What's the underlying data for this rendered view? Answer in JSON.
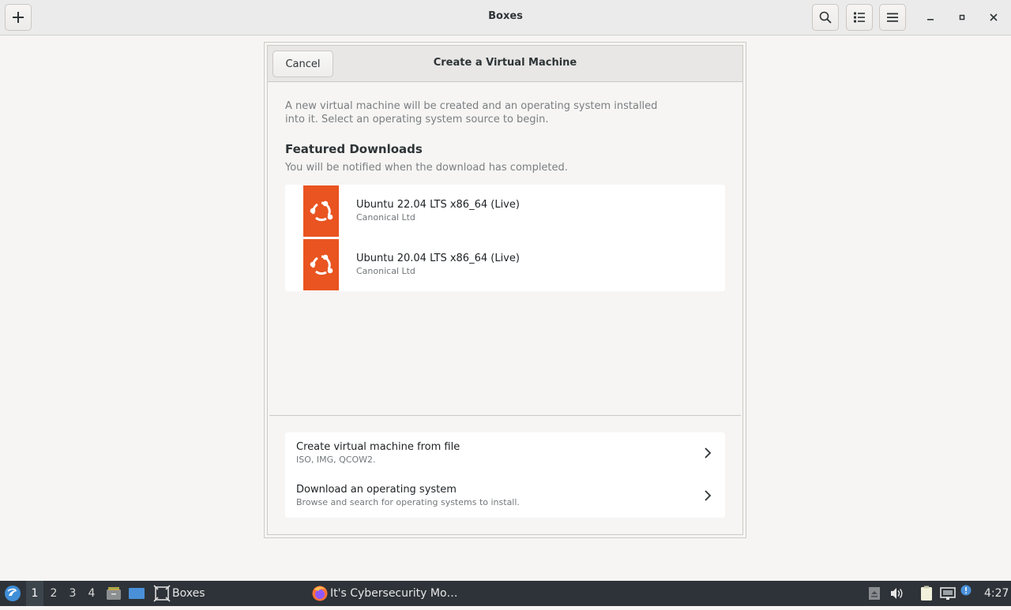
{
  "app": {
    "title": "Boxes"
  },
  "dialog": {
    "cancel_label": "Cancel",
    "title": "Create a Virtual Machine",
    "intro_line1": "A new virtual machine will be created and an operating system installed",
    "intro_line2": "into it. Select an operating system source to begin.",
    "featured_title": "Featured Downloads",
    "featured_subtitle": "You will be notified when the download has completed.",
    "featured": [
      {
        "name": "Ubuntu 22.04 LTS x86_64 (Live)",
        "vendor": "Canonical Ltd",
        "icon": "ubuntu-logo-icon"
      },
      {
        "name": "Ubuntu 20.04 LTS x86_64 (Live)",
        "vendor": "Canonical Ltd",
        "icon": "ubuntu-logo-icon"
      }
    ],
    "sources": [
      {
        "title": "Create virtual machine from file",
        "subtitle": "ISO, IMG, QCOW2."
      },
      {
        "title": "Download an operating system",
        "subtitle": "Browse and search for operating systems to install."
      }
    ]
  },
  "taskbar": {
    "workspaces": [
      "1",
      "2",
      "3",
      "4"
    ],
    "active_workspace": "1",
    "boxes_label": "Boxes",
    "firefox_label": "It's Cybersecurity Mo…",
    "clock": "4:27"
  },
  "colors": {
    "ubuntu_orange": "#e95420",
    "taskbar_bg": "#2d3338",
    "header_bg": "#ebebeb"
  }
}
